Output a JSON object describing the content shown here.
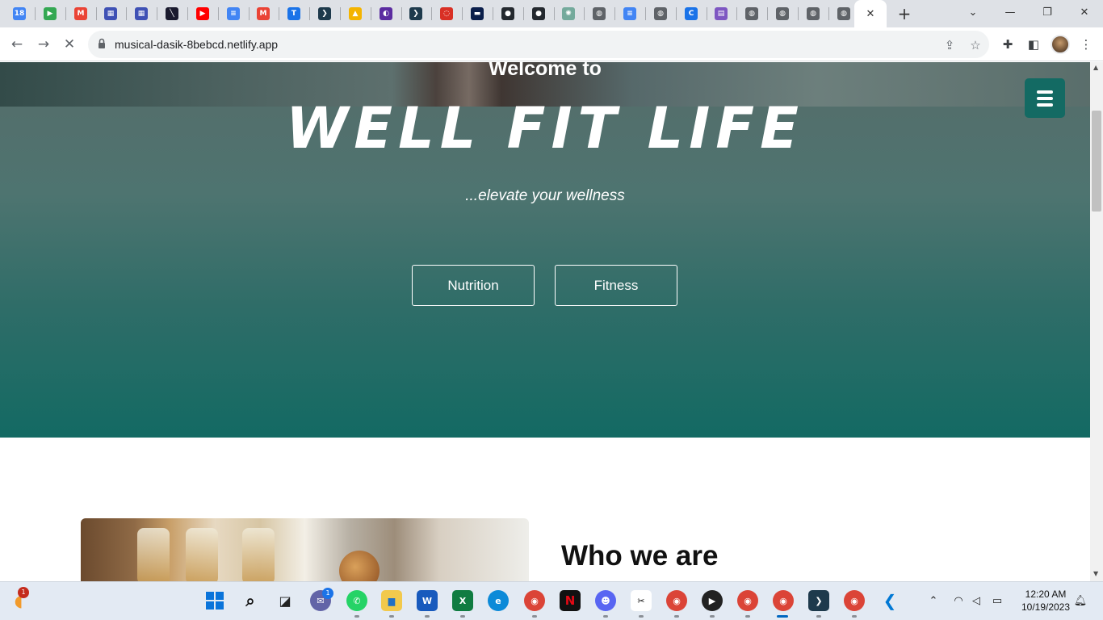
{
  "browser": {
    "url": "musical-dasik-8bebcd.netlify.app",
    "active_tab_close": "✕",
    "new_tab": "+",
    "pinned_tabs": [
      {
        "icon": "calendar-icon",
        "glyph": "18",
        "color": "#4285f4"
      },
      {
        "icon": "meet-icon",
        "glyph": "▶",
        "color": "#34a853"
      },
      {
        "icon": "gmail-icon",
        "glyph": "M",
        "color": "#ea4335"
      },
      {
        "icon": "forms-icon",
        "glyph": "▦",
        "color": "#3f51b5"
      },
      {
        "icon": "forms-icon",
        "glyph": "▦",
        "color": "#3f51b5"
      },
      {
        "icon": "site-icon",
        "glyph": "╲",
        "color": "#1a1a2e"
      },
      {
        "icon": "youtube-icon",
        "glyph": "▶",
        "color": "#ff0000"
      },
      {
        "icon": "docs-icon",
        "glyph": "≡",
        "color": "#4285f4"
      },
      {
        "icon": "gmail-icon",
        "glyph": "M",
        "color": "#ea4335"
      },
      {
        "icon": "tasks-icon",
        "glyph": "T",
        "color": "#1a73e8"
      },
      {
        "icon": "app-icon",
        "glyph": "❯",
        "color": "#1e3a4c"
      },
      {
        "icon": "drive-icon",
        "glyph": "▲",
        "color": "#f4b400"
      },
      {
        "icon": "app-icon",
        "glyph": "◐",
        "color": "#5b2ca0"
      },
      {
        "icon": "app-icon",
        "glyph": "❯",
        "color": "#1e3a4c"
      },
      {
        "icon": "loading-icon",
        "glyph": "◌",
        "color": "#d93025"
      },
      {
        "icon": "site-icon",
        "glyph": "▬",
        "color": "#0b1f4b"
      },
      {
        "icon": "github-icon",
        "glyph": "●",
        "color": "#24292f"
      },
      {
        "icon": "github-icon",
        "glyph": "●",
        "color": "#24292f"
      },
      {
        "icon": "chatgpt-icon",
        "glyph": "✺",
        "color": "#74aa9c"
      },
      {
        "icon": "globe-icon",
        "glyph": "◍",
        "color": "#5f6368"
      },
      {
        "icon": "docs-icon",
        "glyph": "≡",
        "color": "#4285f4"
      },
      {
        "icon": "globe-icon",
        "glyph": "◍",
        "color": "#5f6368"
      },
      {
        "icon": "site-icon",
        "glyph": "C",
        "color": "#1a73e8"
      },
      {
        "icon": "app-icon",
        "glyph": "▤",
        "color": "#7e57c2"
      },
      {
        "icon": "globe-icon",
        "glyph": "◍",
        "color": "#5f6368"
      },
      {
        "icon": "globe-icon",
        "glyph": "◍",
        "color": "#5f6368"
      },
      {
        "icon": "globe-icon",
        "glyph": "◍",
        "color": "#5f6368"
      },
      {
        "icon": "globe-icon",
        "glyph": "◍",
        "color": "#5f6368"
      }
    ]
  },
  "hero": {
    "welcome": "Welcome to",
    "brand": "WELL FIT LIFE",
    "tagline": "...elevate your wellness",
    "buttons": [
      "Nutrition",
      "Fitness"
    ]
  },
  "about": {
    "title": "Who we are"
  },
  "taskbar": {
    "time": "12:20 AM",
    "date": "10/19/2023",
    "weather_badge": "1",
    "meet_badge": "1"
  },
  "colors": {
    "brand_teal": "#136a63",
    "hero_top": "#566c6a"
  }
}
